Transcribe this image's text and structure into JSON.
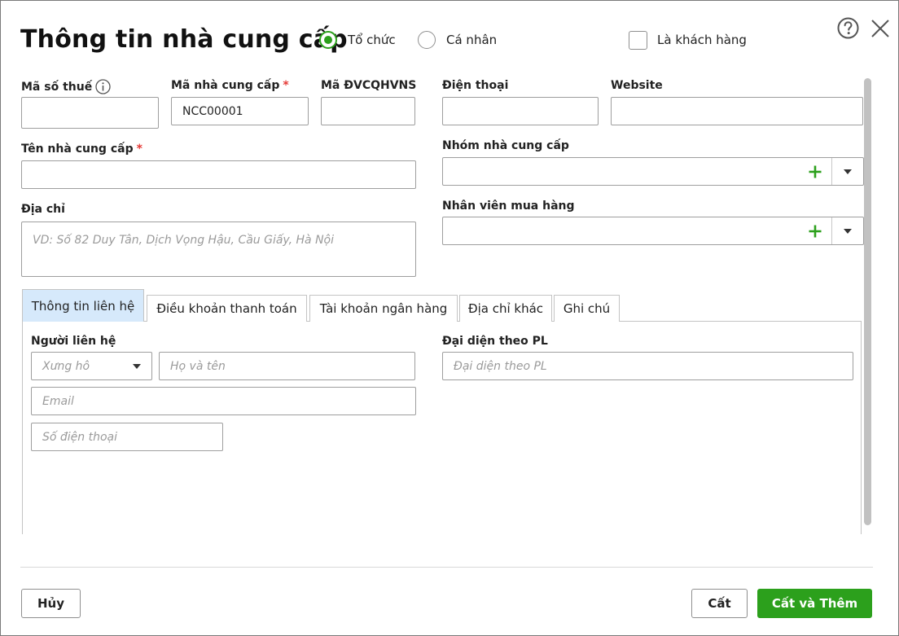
{
  "dialog": {
    "title": "Thông tin nhà cung cấp",
    "type_options": [
      {
        "label": "Tổ chức",
        "selected": true
      },
      {
        "label": "Cá nhân",
        "selected": false
      }
    ],
    "is_customer_label": "Là khách hàng",
    "is_customer_checked": false
  },
  "form": {
    "tax_code": {
      "label": "Mã số thuế",
      "value": ""
    },
    "supplier_code": {
      "label": "Mã nhà cung cấp",
      "required_mark": "*",
      "value": "NCC00001"
    },
    "budget_unit_code": {
      "label": "Mã ĐVCQHVNS",
      "value": ""
    },
    "phone": {
      "label": "Điện thoại",
      "value": ""
    },
    "website": {
      "label": "Website",
      "value": ""
    },
    "supplier_name": {
      "label": "Tên nhà cung cấp",
      "required_mark": "*",
      "value": ""
    },
    "supplier_group": {
      "label": "Nhóm nhà cung cấp",
      "value": ""
    },
    "address": {
      "label": "Địa chỉ",
      "placeholder": "VD: Số 82 Duy Tân, Dịch Vọng Hậu, Cầu Giấy, Hà Nội",
      "value": ""
    },
    "purchasing_staff": {
      "label": "Nhân viên mua hàng",
      "value": ""
    }
  },
  "tabs": [
    {
      "label": "Thông tin liên hệ",
      "active": true
    },
    {
      "label": "Điều khoản thanh toán",
      "active": false
    },
    {
      "label": "Tài khoản ngân hàng",
      "active": false
    },
    {
      "label": "Địa chỉ khác",
      "active": false
    },
    {
      "label": "Ghi chú",
      "active": false
    }
  ],
  "contact": {
    "section_label": "Người liên hệ",
    "salutation_placeholder": "Xưng hô",
    "full_name_placeholder": "Họ và tên",
    "email_placeholder": "Email",
    "phone_placeholder": "Số điện thoại",
    "legal_rep_label": "Đại diện theo PL",
    "legal_rep_placeholder": "Đại diện theo PL"
  },
  "footer": {
    "cancel_label": "Hủy",
    "save_label": "Cất",
    "save_add_label": "Cất và Thêm"
  },
  "colors": {
    "accent": "#2ca01c",
    "required": "#e53935",
    "active_tab": "#d6e9fb"
  }
}
